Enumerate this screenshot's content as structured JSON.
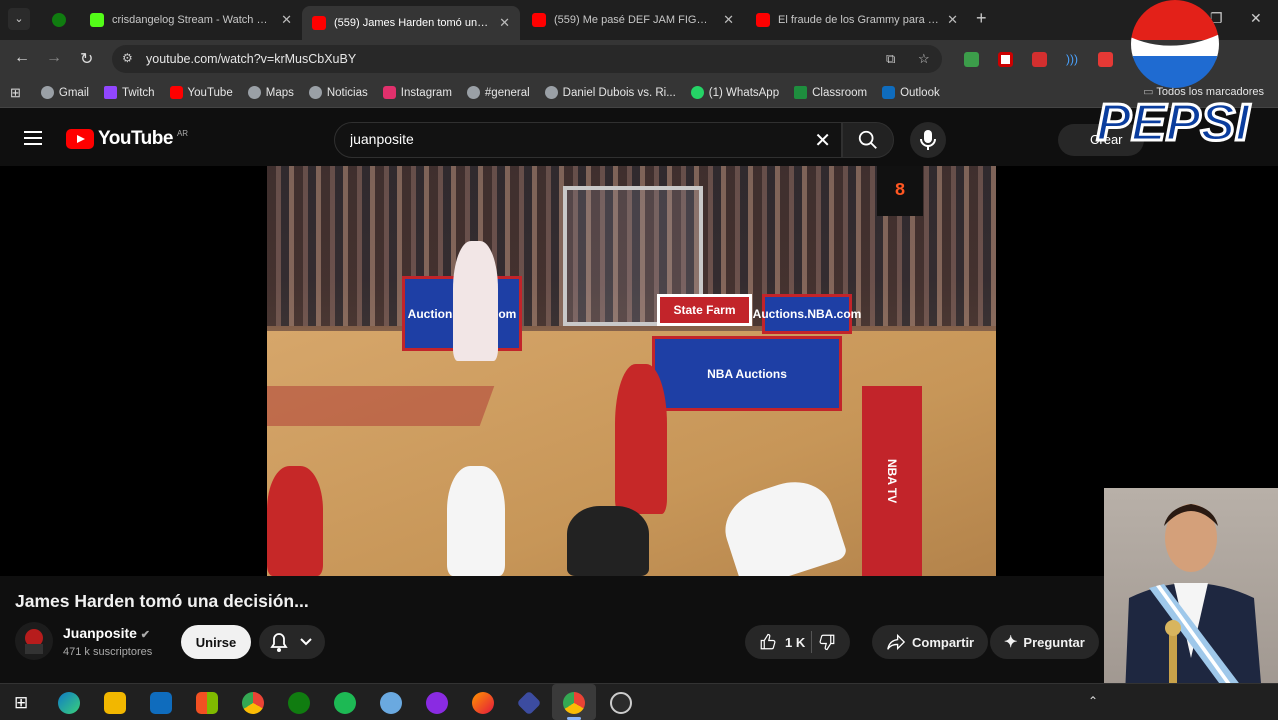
{
  "browser": {
    "tabs": [
      {
        "title": "crisdangelog Stream - Watch Li...",
        "favicon_color": "#53fc18"
      },
      {
        "title": "(559) James Harden tomó una ...",
        "favicon_color": "#ff0000",
        "active": true
      },
      {
        "title": "(559) Me pasé DEF JAM FIGHT ...",
        "favicon_color": "#ff0000"
      },
      {
        "title": "El fraude de los Grammy para v...",
        "favicon_color": "#ff0000"
      }
    ],
    "url": "youtube.com/watch?v=krMusCbXuBY",
    "bookmarks": [
      {
        "label": "Gmail",
        "color": "#9aa0a6"
      },
      {
        "label": "Twitch",
        "color": "#9146ff"
      },
      {
        "label": "YouTube",
        "color": "#ff0000"
      },
      {
        "label": "Maps",
        "color": "#9aa0a6"
      },
      {
        "label": "Noticias",
        "color": "#9aa0a6"
      },
      {
        "label": "Instagram",
        "color": "#e1306c"
      },
      {
        "label": "#general",
        "color": "#9aa0a6"
      },
      {
        "label": "Daniel Dubois vs. Ri...",
        "color": "#9aa0a6"
      },
      {
        "label": "(1) WhatsApp",
        "color": "#25d366"
      },
      {
        "label": "Classroom",
        "color": "#1e8e3e"
      },
      {
        "label": "Outlook",
        "color": "#0f6cbd"
      }
    ],
    "bookmarks_more": "Todos los marcadores"
  },
  "youtube": {
    "logo_text": "YouTube",
    "country_code": "AR",
    "search_value": "juanposite",
    "create_label": "Crear"
  },
  "video": {
    "shot_clock": "8",
    "ad_text_1": "Auctions.NBA.com",
    "ad_text_2": "State Farm",
    "ad_text_3": "NBA Auctions",
    "title": "James Harden tomó una decisión...",
    "channel_name": "Juanposite",
    "subscribers": "471 k suscriptores",
    "join_label": "Unirse",
    "likes": "1 K",
    "share_label": "Compartir",
    "ask_label": "Preguntar"
  },
  "overlay": {
    "brand_text": "PEPSI"
  },
  "colors": {
    "youtube_red": "#ff0000",
    "pepsi_blue": "#0a3d9e"
  }
}
